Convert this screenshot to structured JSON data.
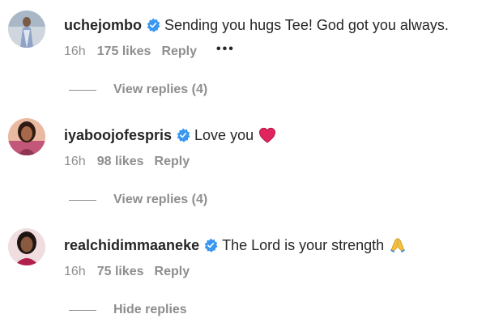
{
  "comments": [
    {
      "username": "uchejombo",
      "text": "Sending you hugs Tee! God got you always.",
      "time": "16h",
      "likes": "175 likes",
      "reply": "Reply",
      "more": "•••",
      "replies_label": "View replies (4)",
      "emoji": ""
    },
    {
      "username": "iyaboojofespris",
      "text": "Love you",
      "time": "16h",
      "likes": "98 likes",
      "reply": "Reply",
      "replies_label": "View replies (4)",
      "emoji": "red-heart"
    },
    {
      "username": "realchidimmaaneke",
      "text": "The Lord is your strength",
      "time": "16h",
      "likes": "75 likes",
      "reply": "Reply",
      "replies_label": "Hide replies",
      "emoji": "folded-hands"
    }
  ],
  "colors": {
    "username": "#262626",
    "secondary": "#8e8e8e",
    "verified_badge": "#3897f0",
    "heart": "#e0245e"
  }
}
